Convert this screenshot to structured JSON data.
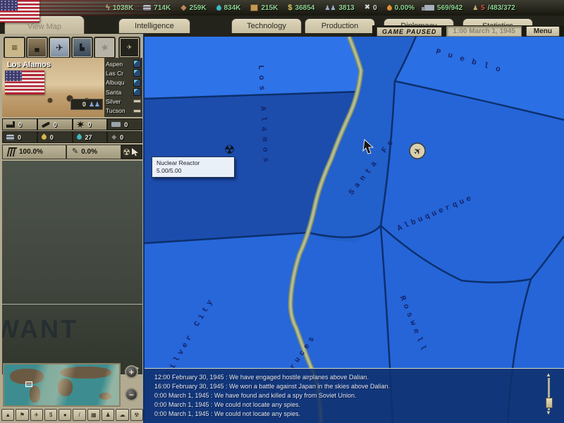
{
  "colors": {
    "resource_green": "#8fd492",
    "map_base_blue": "#2565d8",
    "map_selected_blue": "#1c4dad",
    "boundary_navy": "#0a2a63",
    "river_tan": "#b2bc97",
    "panel_beige": "#d4cbb0"
  },
  "icons": {
    "lightning": "ϟ",
    "hammer": "⚒",
    "diamond": "◆",
    "dollar": "$",
    "pawn": "♟",
    "pawns": "♟♟",
    "cross": "✖",
    "plane": "✈",
    "radiation": "☢",
    "pencil": "✎",
    "flag": "⚑",
    "up_arrow": "▲",
    "down_arrow": "▼",
    "left_arrow": "◄",
    "right_arrow": "►",
    "plus": "+",
    "minus": "−",
    "cloud": "☁",
    "dot": "●",
    "grid": "▦",
    "slash": "/"
  },
  "topbar": {
    "resources": [
      {
        "name": "energy",
        "value": "1038K"
      },
      {
        "name": "metal",
        "value": "714K"
      },
      {
        "name": "rare-materials",
        "value": "259K"
      },
      {
        "name": "oil",
        "value": "834K"
      },
      {
        "name": "supplies",
        "value": "215K"
      },
      {
        "name": "money",
        "value": "36854"
      },
      {
        "name": "manpower",
        "value": "3813"
      },
      {
        "name": "convoys",
        "value": "0"
      },
      {
        "name": "dissent",
        "value": "0.00%"
      },
      {
        "name": "transport-capacity",
        "value": "569/942"
      },
      {
        "name": "forces",
        "value_red": "5",
        "value": "/483/372"
      }
    ]
  },
  "tabs": {
    "items": [
      {
        "label": "View Map"
      },
      {
        "label": "Intelligence"
      },
      {
        "label": "Technology"
      },
      {
        "label": "Production"
      },
      {
        "label": "Diplomacy"
      },
      {
        "label": "Statistics"
      }
    ]
  },
  "pause_bar": {
    "paused": "GAME PAUSED",
    "date": "1:00 March 1, 1945",
    "menu": "Menu"
  },
  "sidebar": {
    "province": {
      "name": "Los Alamos",
      "adjacent": [
        {
          "label": "Aspen"
        },
        {
          "label": "Las Cr"
        },
        {
          "label": "Albuqu"
        },
        {
          "label": "Santa"
        },
        {
          "label": "Silver"
        },
        {
          "label": "Tucson"
        }
      ],
      "units_in_province": "0",
      "stats": [
        {
          "name": "factories",
          "value": "0"
        },
        {
          "name": "coastal-guns",
          "value": "0"
        },
        {
          "name": "anti-air",
          "value": "0"
        },
        {
          "name": "convoys",
          "value": "0"
        }
      ],
      "resources": [
        {
          "name": "metal",
          "value": "0"
        },
        {
          "name": "energy",
          "value": "0"
        },
        {
          "name": "oil",
          "value": "27"
        },
        {
          "name": "rare-materials",
          "value": "0"
        }
      ],
      "infrastructure": "100.0%",
      "revolt_risk": "0.0%"
    },
    "poster_text": "WANT"
  },
  "map": {
    "labels": [
      {
        "text": "Los Alamos"
      },
      {
        "text": "Santa Fe"
      },
      {
        "text": "Pueblo"
      },
      {
        "text": "Albuquerque"
      },
      {
        "text": "Silver City"
      },
      {
        "text": "Las Cruces"
      },
      {
        "text": "Roswell"
      }
    ],
    "tooltip": {
      "title": "Nuclear Reactor",
      "value": "5.00/5.00"
    }
  },
  "log": {
    "messages": [
      {
        "text": "12:00 February 30, 1945 : We have engaged hostile airplanes above Dalian."
      },
      {
        "text": "16:00 February 30, 1945 : We won a battle against Japan in the skies above Dalian."
      },
      {
        "text": "0:00 March 1, 1945 : We have found and killed a spy from Soviet Union."
      },
      {
        "text": "0:00 March 1, 1945 : We could not locate any spies."
      },
      {
        "text": "0:00 March 1, 1945 : We could not locate any spies."
      }
    ]
  }
}
